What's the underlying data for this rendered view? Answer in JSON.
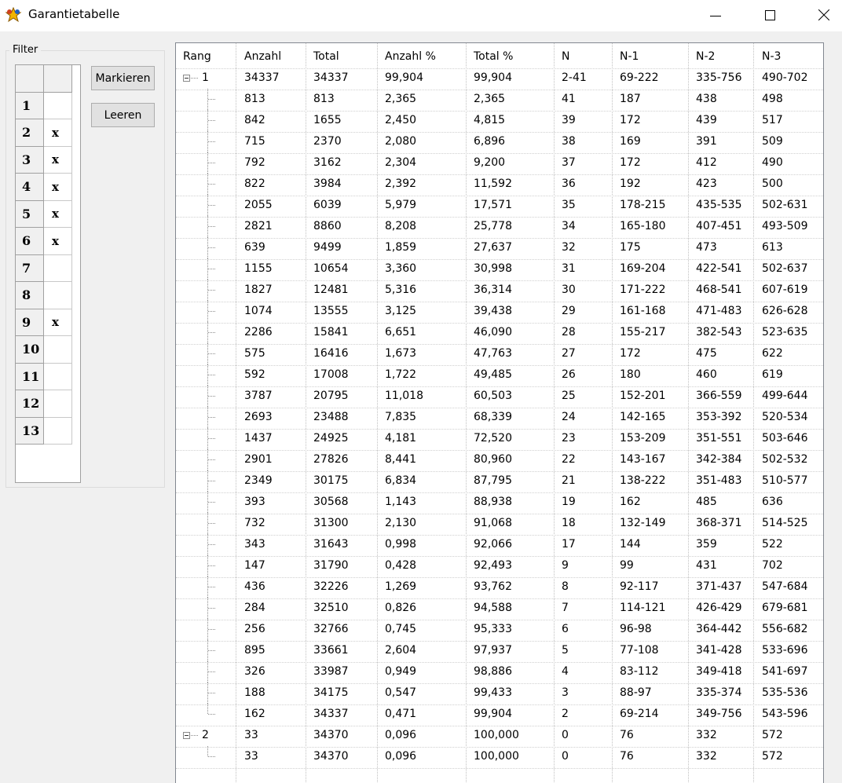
{
  "window": {
    "title": "Garantietabelle",
    "icon": "app-star-icon"
  },
  "filter": {
    "legend": "Filter",
    "rows": [
      {
        "n": "1",
        "mark": ""
      },
      {
        "n": "2",
        "mark": "x"
      },
      {
        "n": "3",
        "mark": "x"
      },
      {
        "n": "4",
        "mark": "x"
      },
      {
        "n": "5",
        "mark": "x"
      },
      {
        "n": "6",
        "mark": "x"
      },
      {
        "n": "7",
        "mark": ""
      },
      {
        "n": "8",
        "mark": ""
      },
      {
        "n": "9",
        "mark": "x"
      },
      {
        "n": "10",
        "mark": ""
      },
      {
        "n": "11",
        "mark": ""
      },
      {
        "n": "12",
        "mark": ""
      },
      {
        "n": "13",
        "mark": ""
      }
    ]
  },
  "buttons": {
    "mark_label": "Markieren",
    "clear_label": "Leeren"
  },
  "table": {
    "columns": [
      "Rang",
      "Anzahl",
      "Total",
      "Anzahl %",
      "Total %",
      "N",
      "N-1",
      "N-2",
      "N-3"
    ],
    "rows": [
      {
        "group": true,
        "rang": "1",
        "cells": [
          "34337",
          "34337",
          "99,904",
          "99,904",
          "2-41",
          "69-222",
          "335-756",
          "490-702"
        ]
      },
      {
        "cells": [
          "813",
          "813",
          "2,365",
          "2,365",
          "41",
          "187",
          "438",
          "498"
        ]
      },
      {
        "cells": [
          "842",
          "1655",
          "2,450",
          "4,815",
          "39",
          "172",
          "439",
          "517"
        ]
      },
      {
        "cells": [
          "715",
          "2370",
          "2,080",
          "6,896",
          "38",
          "169",
          "391",
          "509"
        ]
      },
      {
        "cells": [
          "792",
          "3162",
          "2,304",
          "9,200",
          "37",
          "172",
          "412",
          "490"
        ]
      },
      {
        "cells": [
          "822",
          "3984",
          "2,392",
          "11,592",
          "36",
          "192",
          "423",
          "500"
        ]
      },
      {
        "cells": [
          "2055",
          "6039",
          "5,979",
          "17,571",
          "35",
          "178-215",
          "435-535",
          "502-631"
        ]
      },
      {
        "cells": [
          "2821",
          "8860",
          "8,208",
          "25,778",
          "34",
          "165-180",
          "407-451",
          "493-509"
        ]
      },
      {
        "cells": [
          "639",
          "9499",
          "1,859",
          "27,637",
          "32",
          "175",
          "473",
          "613"
        ]
      },
      {
        "cells": [
          "1155",
          "10654",
          "3,360",
          "30,998",
          "31",
          "169-204",
          "422-541",
          "502-637"
        ]
      },
      {
        "cells": [
          "1827",
          "12481",
          "5,316",
          "36,314",
          "30",
          "171-222",
          "468-541",
          "607-619"
        ]
      },
      {
        "cells": [
          "1074",
          "13555",
          "3,125",
          "39,438",
          "29",
          "161-168",
          "471-483",
          "626-628"
        ]
      },
      {
        "cells": [
          "2286",
          "15841",
          "6,651",
          "46,090",
          "28",
          "155-217",
          "382-543",
          "523-635"
        ]
      },
      {
        "cells": [
          "575",
          "16416",
          "1,673",
          "47,763",
          "27",
          "172",
          "475",
          "622"
        ]
      },
      {
        "cells": [
          "592",
          "17008",
          "1,722",
          "49,485",
          "26",
          "180",
          "460",
          "619"
        ]
      },
      {
        "cells": [
          "3787",
          "20795",
          "11,018",
          "60,503",
          "25",
          "152-201",
          "366-559",
          "499-644"
        ]
      },
      {
        "cells": [
          "2693",
          "23488",
          "7,835",
          "68,339",
          "24",
          "142-165",
          "353-392",
          "520-534"
        ]
      },
      {
        "cells": [
          "1437",
          "24925",
          "4,181",
          "72,520",
          "23",
          "153-209",
          "351-551",
          "503-646"
        ]
      },
      {
        "cells": [
          "2901",
          "27826",
          "8,441",
          "80,960",
          "22",
          "143-167",
          "342-384",
          "502-532"
        ]
      },
      {
        "cells": [
          "2349",
          "30175",
          "6,834",
          "87,795",
          "21",
          "138-222",
          "351-483",
          "510-577"
        ]
      },
      {
        "cells": [
          "393",
          "30568",
          "1,143",
          "88,938",
          "19",
          "162",
          "485",
          "636"
        ]
      },
      {
        "cells": [
          "732",
          "31300",
          "2,130",
          "91,068",
          "18",
          "132-149",
          "368-371",
          "514-525"
        ]
      },
      {
        "cells": [
          "343",
          "31643",
          "0,998",
          "92,066",
          "17",
          "144",
          "359",
          "522"
        ]
      },
      {
        "cells": [
          "147",
          "31790",
          "0,428",
          "92,493",
          "9",
          "99",
          "431",
          "702"
        ]
      },
      {
        "cells": [
          "436",
          "32226",
          "1,269",
          "93,762",
          "8",
          "92-117",
          "371-437",
          "547-684"
        ]
      },
      {
        "cells": [
          "284",
          "32510",
          "0,826",
          "94,588",
          "7",
          "114-121",
          "426-429",
          "679-681"
        ]
      },
      {
        "cells": [
          "256",
          "32766",
          "0,745",
          "95,333",
          "6",
          "96-98",
          "364-442",
          "556-682"
        ]
      },
      {
        "cells": [
          "895",
          "33661",
          "2,604",
          "97,937",
          "5",
          "77-108",
          "341-428",
          "533-696"
        ]
      },
      {
        "cells": [
          "326",
          "33987",
          "0,949",
          "98,886",
          "4",
          "83-112",
          "349-418",
          "541-697"
        ]
      },
      {
        "cells": [
          "188",
          "34175",
          "0,547",
          "99,433",
          "3",
          "88-97",
          "335-374",
          "535-536"
        ]
      },
      {
        "cells": [
          "162",
          "34337",
          "0,471",
          "99,904",
          "2",
          "69-214",
          "349-756",
          "543-596"
        ]
      },
      {
        "group": true,
        "rang": "2",
        "cells": [
          "33",
          "34370",
          "0,096",
          "100,000",
          "0",
          "76",
          "332",
          "572"
        ]
      },
      {
        "cells": [
          "33",
          "34370",
          "0,096",
          "100,000",
          "0",
          "76",
          "332",
          "572"
        ]
      }
    ]
  }
}
